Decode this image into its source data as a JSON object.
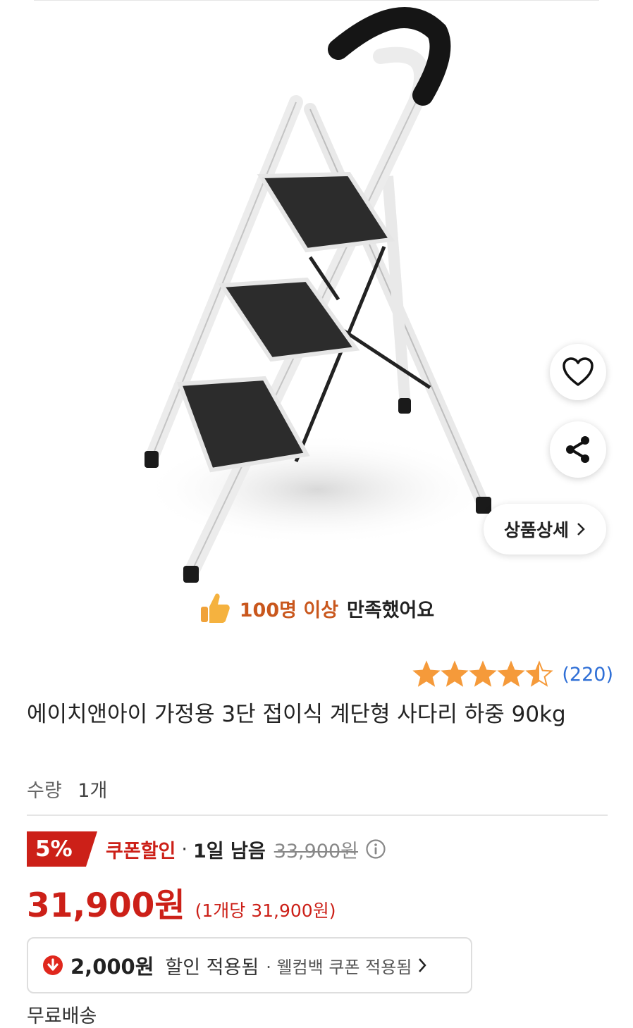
{
  "detail_button": {
    "label": "상품상세"
  },
  "satisfaction": {
    "highlight": "100명 이상",
    "rest": "만족했어요"
  },
  "rating": {
    "stars": 4.5,
    "count": "(220)",
    "star_color": "#f59a3a"
  },
  "product": {
    "title": "에이치앤아이 가정용 3단 접이식 계단형 사다리 하중 90kg",
    "quantity_label": "수량",
    "quantity_value": "1개"
  },
  "coupon": {
    "percent": "5%",
    "label": "쿠폰할인",
    "separator": "·",
    "remaining": "1일 남음",
    "original_price": "33,900원"
  },
  "price": {
    "final": "31,900원",
    "unit": "(1개당 31,900원)",
    "accent": "#cc2018"
  },
  "discount": {
    "amount": "2,000원",
    "applied": "할인 적용됨",
    "welcome": "· 웰컴백 쿠폰 적용됨"
  },
  "shipping_cutoff": "무료배송"
}
